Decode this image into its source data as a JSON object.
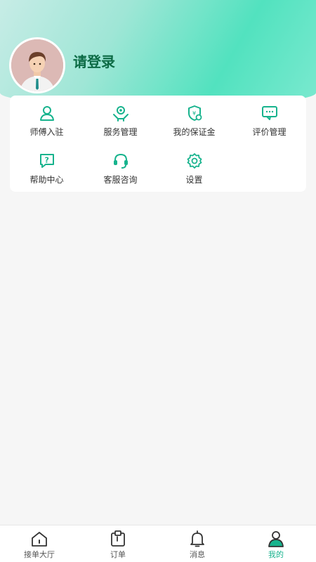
{
  "profile": {
    "login_label": "请登录"
  },
  "menu": [
    {
      "label": "师傅入驻",
      "icon": "user-icon"
    },
    {
      "label": "服务管理",
      "icon": "hand-gear-icon"
    },
    {
      "label": "我的保证金",
      "icon": "shield-money-icon"
    },
    {
      "label": "评价管理",
      "icon": "comment-icon"
    },
    {
      "label": "帮助中心",
      "icon": "help-icon"
    },
    {
      "label": "客服咨询",
      "icon": "headset-icon"
    },
    {
      "label": "设置",
      "icon": "gear-icon"
    }
  ],
  "tabs": [
    {
      "label": "接单大厅",
      "icon": "home-icon"
    },
    {
      "label": "订单",
      "icon": "clipboard-icon"
    },
    {
      "label": "消息",
      "icon": "bell-icon"
    },
    {
      "label": "我的",
      "icon": "profile-icon",
      "active": true
    }
  ],
  "colors": {
    "accent": "#17b38d",
    "title": "#0c6b45"
  }
}
